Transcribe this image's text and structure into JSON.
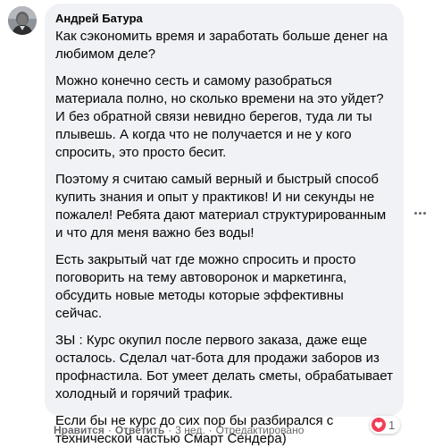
{
  "comment": {
    "author": "Андрей Батура",
    "paragraphs": [
      "Как сэкономить время и заработать больше денег на любимом деле?",
      "Можно конечно сесть и самому разобраться материала полно, но сколько времени на это уйдет? И без обратной связи невидно берегов, туда ли ты плывешь. А когда что не получается и не у кого спросить, это просто бесит.",
      "Поэтому я считаю самый верный и быстрый способ купить знания и опыт у практиков! И ни секунды не пожалел! Ребята дают материал структурированным и что для меня важно без воды!",
      "Есть закрытый чат где можно спросить и просто поговорить на тему автоворонок и маркетинга, обсудить новые методы которые эффективны сейчас.",
      "ЗЫ : Курс окупил после первого заказа, даже еще осталось. Сделал чат-бота для продажи заборов из профнастила. Бот умеет делать сметы, обрабатывает холодный и горячий трафик.",
      "Если бы не курс до сих пор бы разбирался с технической частью Смарт Сендера)"
    ],
    "reaction_count": "1",
    "reaction_icon": "heart-icon",
    "actions": {
      "like": "Нравится",
      "reply": "Ответить",
      "time": "3 нед.",
      "edited": "Отредактировано"
    },
    "colors": {
      "bubble": "#f0f2f5",
      "text": "#050505",
      "meta": "#65676b",
      "heart": "#f33e58"
    }
  }
}
